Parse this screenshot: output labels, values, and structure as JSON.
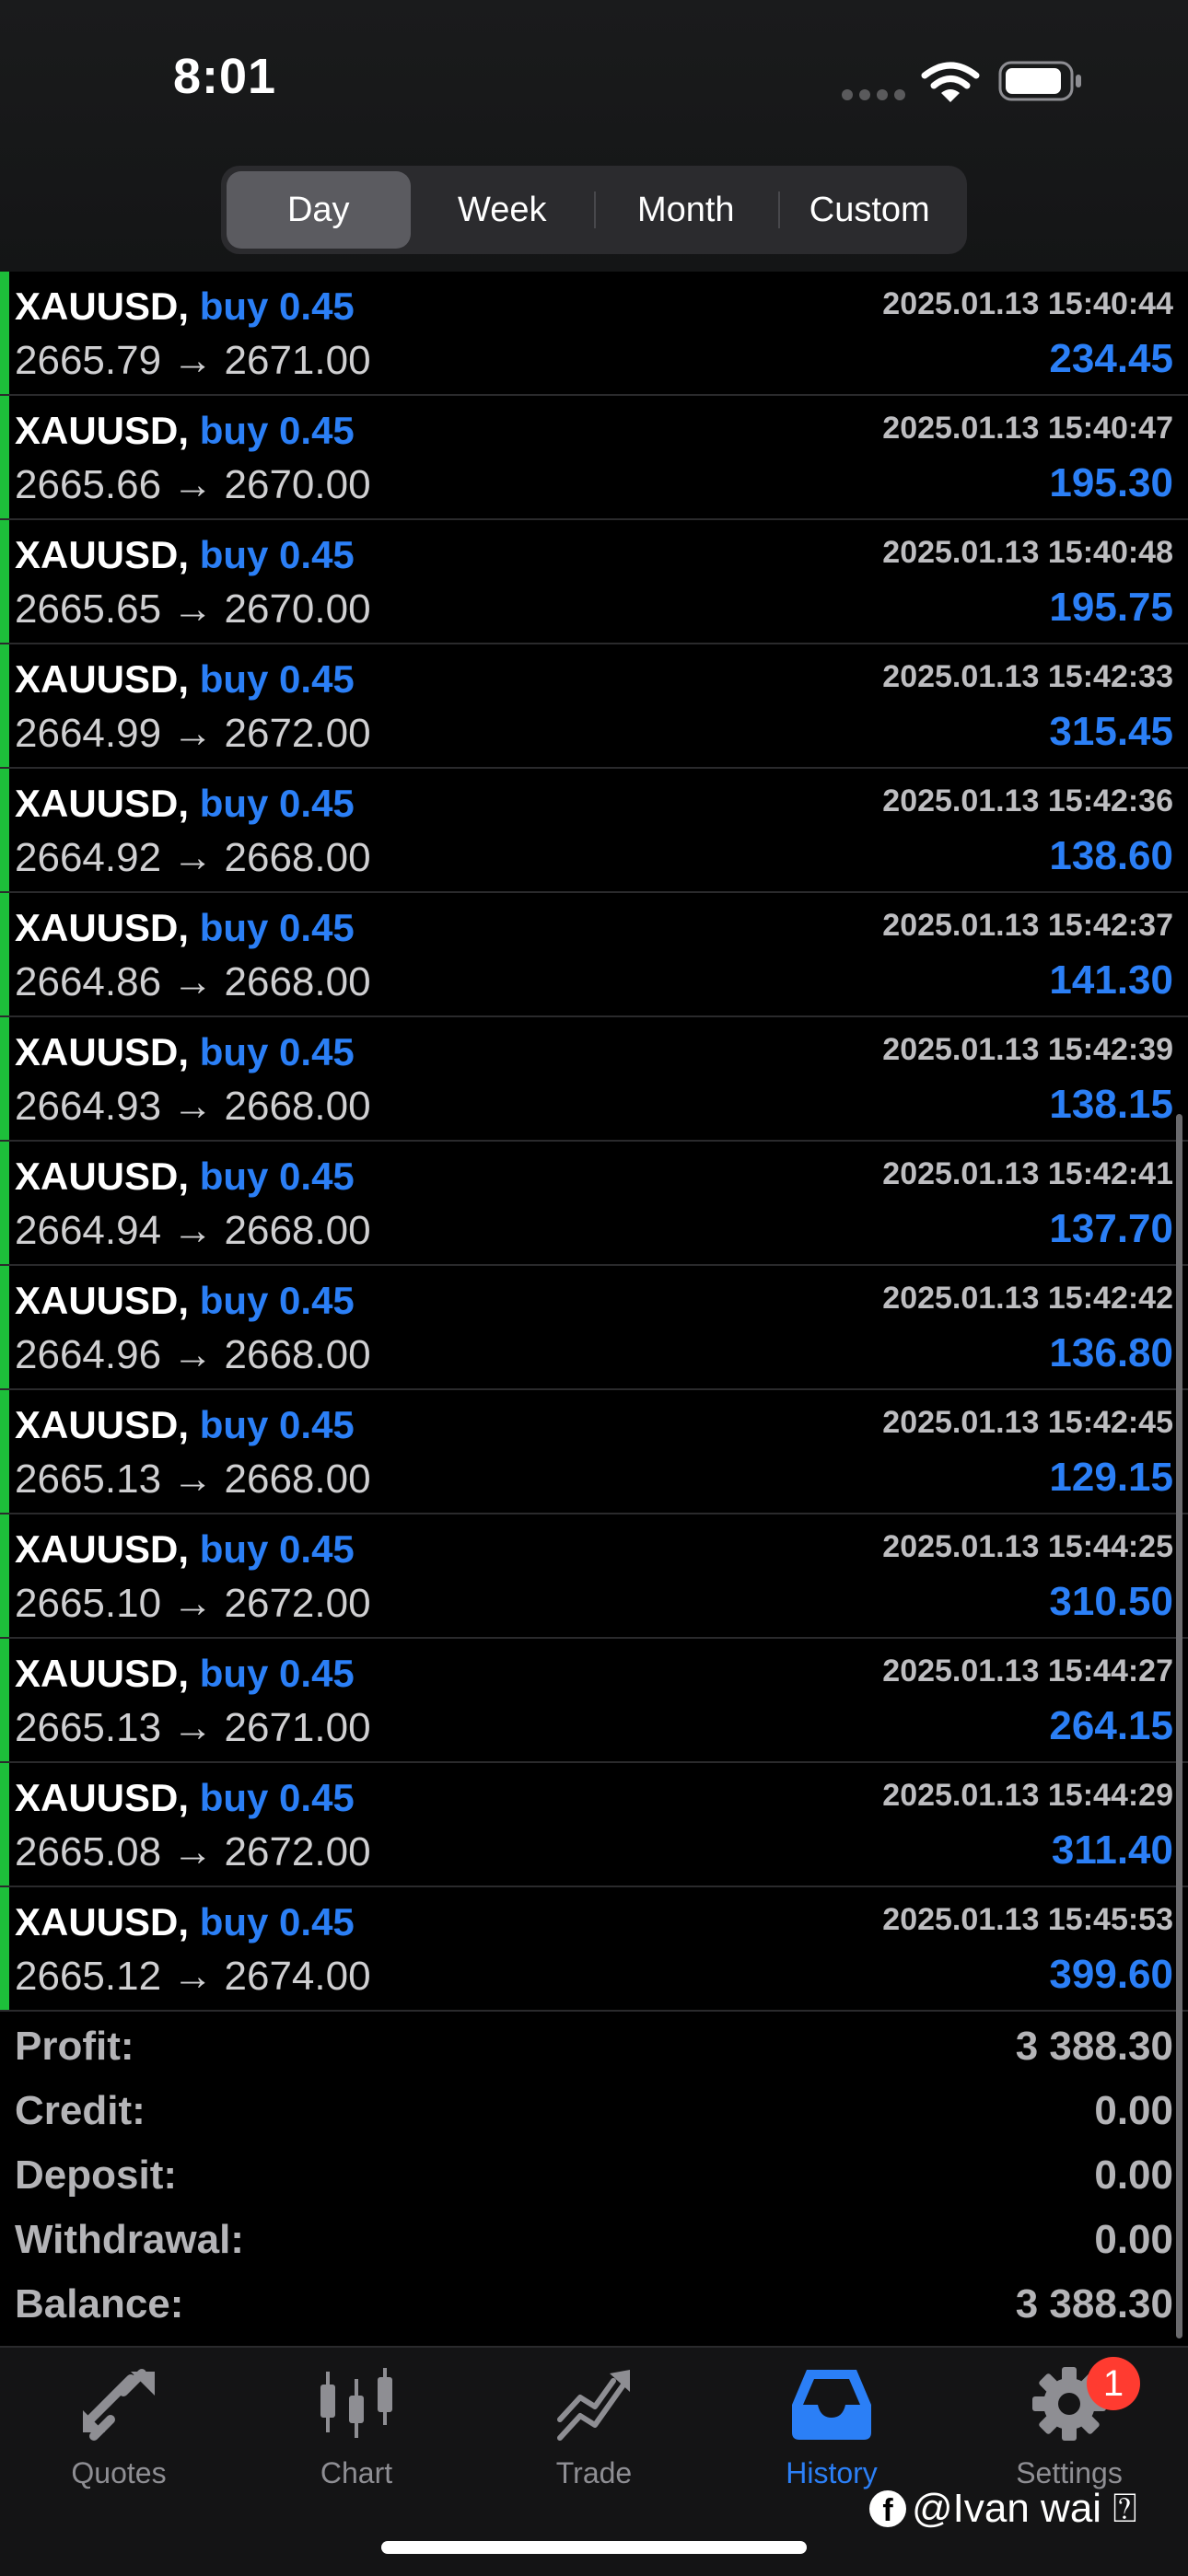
{
  "status_bar": {
    "time": "8:01"
  },
  "period_tabs": [
    {
      "label": "Day",
      "active": true
    },
    {
      "label": "Week",
      "active": false
    },
    {
      "label": "Month",
      "active": false
    },
    {
      "label": "Custom",
      "active": false
    }
  ],
  "deals": [
    {
      "symbol": "XAUUSD,",
      "side": "buy 0.45",
      "prices": "2665.79 → 2671.00",
      "time": "2025.01.13 15:40:44",
      "profit": "234.45"
    },
    {
      "symbol": "XAUUSD,",
      "side": "buy 0.45",
      "prices": "2665.66 → 2670.00",
      "time": "2025.01.13 15:40:47",
      "profit": "195.30"
    },
    {
      "symbol": "XAUUSD,",
      "side": "buy 0.45",
      "prices": "2665.65 → 2670.00",
      "time": "2025.01.13 15:40:48",
      "profit": "195.75"
    },
    {
      "symbol": "XAUUSD,",
      "side": "buy 0.45",
      "prices": "2664.99 → 2672.00",
      "time": "2025.01.13 15:42:33",
      "profit": "315.45"
    },
    {
      "symbol": "XAUUSD,",
      "side": "buy 0.45",
      "prices": "2664.92 → 2668.00",
      "time": "2025.01.13 15:42:36",
      "profit": "138.60"
    },
    {
      "symbol": "XAUUSD,",
      "side": "buy 0.45",
      "prices": "2664.86 → 2668.00",
      "time": "2025.01.13 15:42:37",
      "profit": "141.30"
    },
    {
      "symbol": "XAUUSD,",
      "side": "buy 0.45",
      "prices": "2664.93 → 2668.00",
      "time": "2025.01.13 15:42:39",
      "profit": "138.15"
    },
    {
      "symbol": "XAUUSD,",
      "side": "buy 0.45",
      "prices": "2664.94 → 2668.00",
      "time": "2025.01.13 15:42:41",
      "profit": "137.70"
    },
    {
      "symbol": "XAUUSD,",
      "side": "buy 0.45",
      "prices": "2664.96 → 2668.00",
      "time": "2025.01.13 15:42:42",
      "profit": "136.80"
    },
    {
      "symbol": "XAUUSD,",
      "side": "buy 0.45",
      "prices": "2665.13 → 2668.00",
      "time": "2025.01.13 15:42:45",
      "profit": "129.15"
    },
    {
      "symbol": "XAUUSD,",
      "side": "buy 0.45",
      "prices": "2665.10 → 2672.00",
      "time": "2025.01.13 15:44:25",
      "profit": "310.50"
    },
    {
      "symbol": "XAUUSD,",
      "side": "buy 0.45",
      "prices": "2665.13 → 2671.00",
      "time": "2025.01.13 15:44:27",
      "profit": "264.15"
    },
    {
      "symbol": "XAUUSD,",
      "side": "buy 0.45",
      "prices": "2665.08 → 2672.00",
      "time": "2025.01.13 15:44:29",
      "profit": "311.40"
    },
    {
      "symbol": "XAUUSD,",
      "side": "buy 0.45",
      "prices": "2665.12 → 2674.00",
      "time": "2025.01.13 15:45:53",
      "profit": "399.60"
    }
  ],
  "summary": [
    {
      "label": "Profit:",
      "value": "3 388.30"
    },
    {
      "label": "Credit:",
      "value": "0.00"
    },
    {
      "label": "Deposit:",
      "value": "0.00"
    },
    {
      "label": "Withdrawal:",
      "value": "0.00"
    },
    {
      "label": "Balance:",
      "value": "3 388.30"
    }
  ],
  "tabbar": [
    {
      "label": "Quotes",
      "icon": "quotes-arrows-icon",
      "active": false
    },
    {
      "label": "Chart",
      "icon": "candlestick-chart-icon",
      "active": false
    },
    {
      "label": "Trade",
      "icon": "trade-trend-icon",
      "active": false
    },
    {
      "label": "History",
      "icon": "history-inbox-icon",
      "active": true
    },
    {
      "label": "Settings",
      "icon": "gear-icon",
      "active": false
    }
  ],
  "settings_badge": "1",
  "watermark": {
    "fb_letter": "f",
    "text": "@Ivan wai ⍰"
  },
  "colors": {
    "accent_blue": "#2b7ff6",
    "buy_stripe_green": "#1dbf3a",
    "badge_red": "#ff3b30"
  }
}
